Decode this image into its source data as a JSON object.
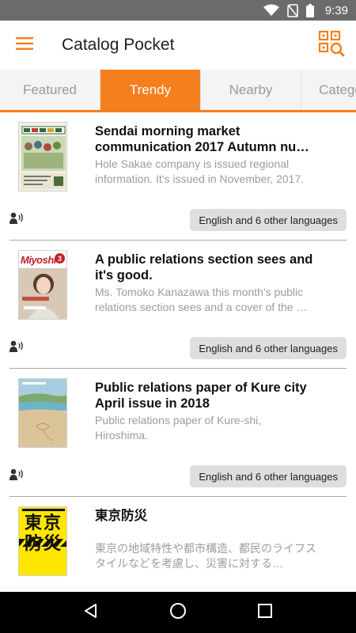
{
  "status_bar": {
    "time": "9:39"
  },
  "app_bar": {
    "title": "Catalog Pocket"
  },
  "tabs": [
    {
      "label": "Featured",
      "active": false
    },
    {
      "label": "Trendy",
      "active": true
    },
    {
      "label": "Nearby",
      "active": false
    },
    {
      "label": "Catego",
      "active": false
    }
  ],
  "items": [
    {
      "title": "Sendai morning market communication  2017  Autumn nu…",
      "description": "Hole Sakae company is issued regional information. It's issued in November, 2017.",
      "languages": "English and 6 other languages"
    },
    {
      "title": "A public relations section sees and it's good.",
      "description": "Ms. Tomoko Kanazawa this month's public relations section sees and a cover of the …",
      "languages": "English and 6 other languages",
      "cover_text": "Miyoshi",
      "cover_number": "3"
    },
    {
      "title": "Public relations paper of Kure city April issue in 2018",
      "description": "Public relations paper of Kure-shi, Hiroshima.",
      "languages": "English and 6 other languages"
    },
    {
      "title": "東京防災",
      "description": "東京の地域特性や都市構造、都民のライフスタイルなどを考慮し、災害に対する…",
      "languages": "",
      "cover_text": "東京防災"
    }
  ],
  "colors": {
    "accent": "#f47f1f",
    "status_bar": "#6b6b6b",
    "chip": "#dedede"
  },
  "icons": [
    "menu-icon",
    "qr-search-icon",
    "audio-guide-icon",
    "back-icon",
    "home-icon",
    "recents-icon",
    "wifi-icon",
    "no-sim-icon",
    "battery-icon"
  ]
}
